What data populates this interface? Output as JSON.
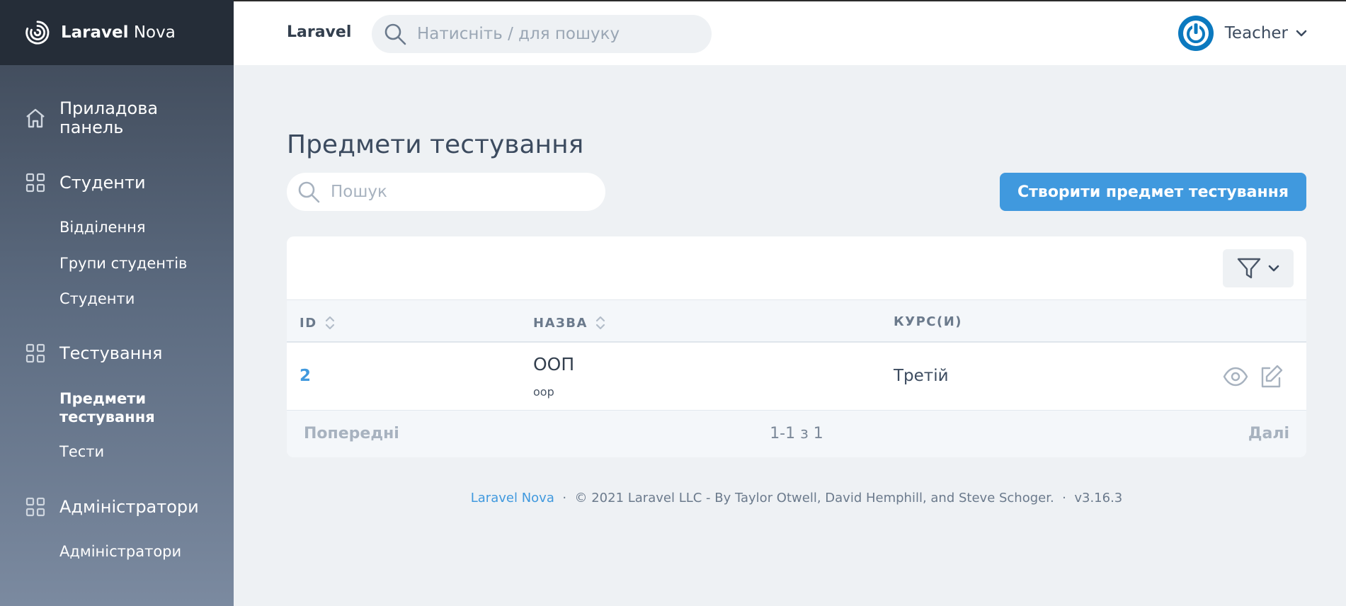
{
  "sidebar": {
    "brand_bold": "Laravel",
    "brand_light": " Nova",
    "dashboard": "Приладова панель",
    "students_group": "Студенти",
    "students_items": [
      "Відділення",
      "Групи студентів",
      "Студенти"
    ],
    "testing_group": "Тестування",
    "testing_items": [
      "Предмети тестування",
      "Тести"
    ],
    "admins_group": "Адміністратори",
    "admins_items": [
      "Адміністратори"
    ]
  },
  "topbar": {
    "brand": "Laravel",
    "search_placeholder": "Натисніть / для пошуку",
    "user_name": "Teacher",
    "accent": "#0b79bf"
  },
  "main": {
    "title": "Предмети тестування",
    "search_placeholder": "Пошук",
    "create_label": "Створити предмет тестування",
    "columns": [
      "ID",
      "НАЗВА",
      "КУРС(И)"
    ],
    "rows": [
      {
        "id": "2",
        "name": "ООП",
        "subtitle": "oop",
        "course": "Третій"
      }
    ],
    "pagination": {
      "prev": "Попередні",
      "count": "1-1 з 1",
      "next": "Далі"
    }
  },
  "footer": {
    "link": "Laravel Nova",
    "copyright": "© 2021 Laravel LLC - By Taylor Otwell, David Hemphill, and Steve Schoger.",
    "version": "v3.16.3",
    "separator": "·"
  },
  "colors": {
    "primary": "#4099de",
    "sidebar_dark": "#252d38"
  },
  "icons": [
    "nova-logo-icon",
    "home-icon",
    "grid-icon",
    "search-icon",
    "power-avatar-icon",
    "chevron-down-icon",
    "filter-icon",
    "sort-icon",
    "eye-icon",
    "edit-icon"
  ]
}
